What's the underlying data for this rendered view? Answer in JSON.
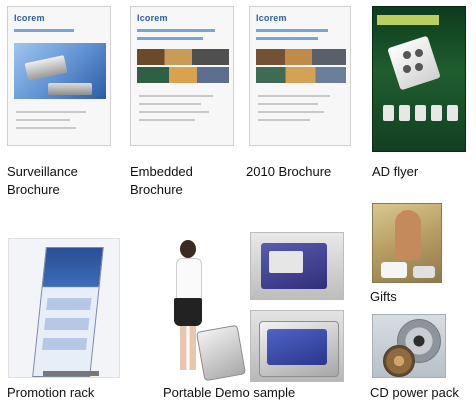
{
  "gallery": {
    "surveillance": {
      "caption_line1": "Surveillance",
      "caption_line2": "Brochure"
    },
    "embedded": {
      "caption_line1": "Embedded",
      "caption_line2": "Brochure"
    },
    "brochure_2010": {
      "caption": "2010 Brochure"
    },
    "ad_flyer": {
      "caption": "AD flyer"
    },
    "gifts": {
      "caption": "Gifts"
    },
    "promotion_rack": {
      "caption": "Promotion rack"
    },
    "portable_demo": {
      "caption": "Portable Demo sample"
    },
    "cd_power_pack": {
      "caption": "CD power pack"
    }
  }
}
